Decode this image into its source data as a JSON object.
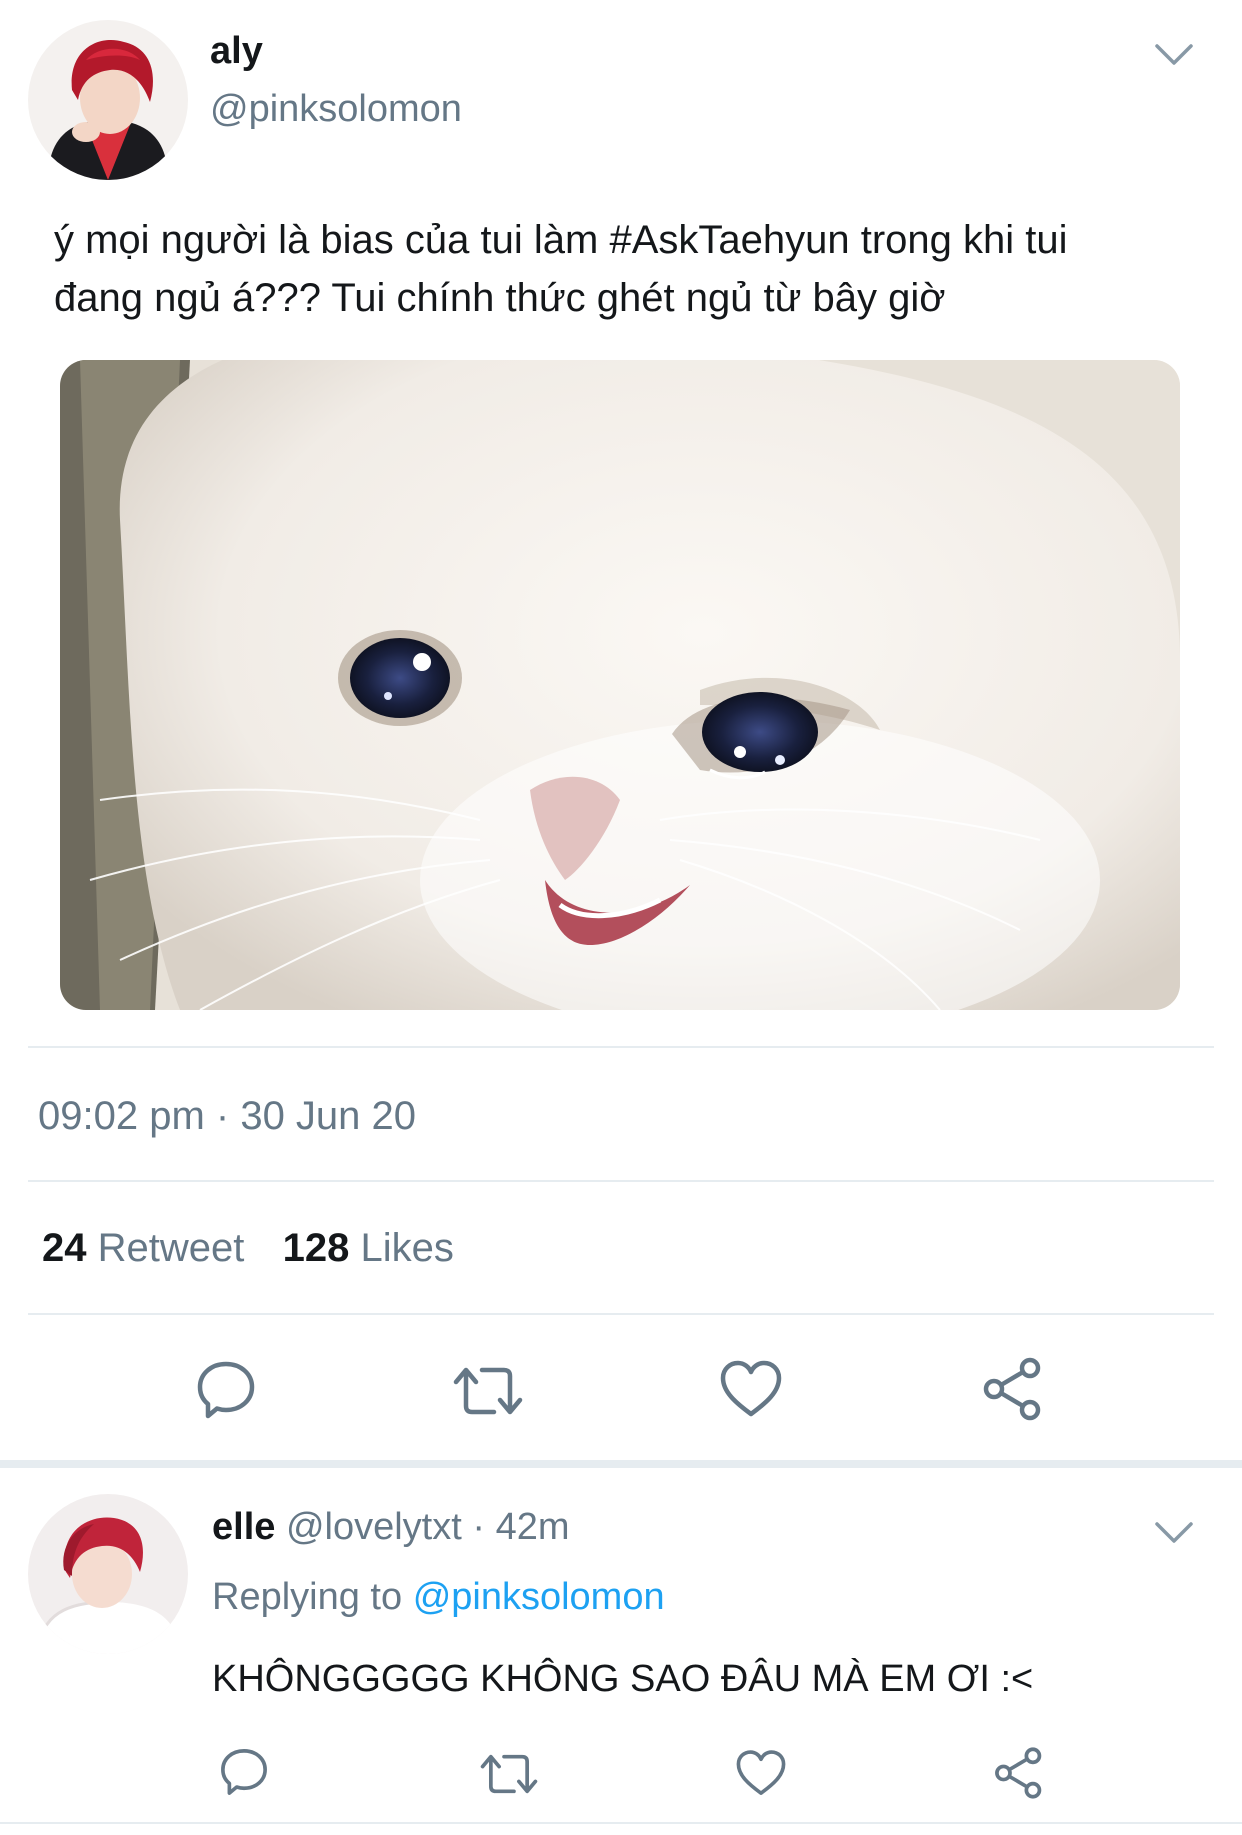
{
  "tweet": {
    "display_name": "aly",
    "handle": "@pinksolomon",
    "text_line1": "ý mọi người là bias của tui làm #AskTaehyun trong khi tui",
    "text_line2": "đang ngủ á??? Tui chính thức ghét ngủ từ bây giờ",
    "timestamp": "09:02 pm · 30 Jun 20",
    "retweet_count": "24",
    "retweet_label": "Retweet",
    "likes_count": "128",
    "likes_label": "Likes",
    "media_icon": "crying-cat-image"
  },
  "actions": {
    "reply_icon": "reply-icon",
    "retweet_icon": "retweet-icon",
    "like_icon": "heart-icon",
    "share_icon": "share-icon"
  },
  "reply": {
    "display_name": "elle",
    "handle": "@lovelytxt",
    "separator": "·",
    "time": "42m",
    "replying_to_label": "Replying to",
    "replying_to_handle": "@pinksolomon",
    "text": "KHÔNGGGGG KHÔNG SAO ĐÂU MÀ EM ƠI :<"
  },
  "colors": {
    "accent": "#1da1f2",
    "secondary_text": "#657786",
    "divider": "#e6ecf0",
    "icon": "#657786"
  }
}
